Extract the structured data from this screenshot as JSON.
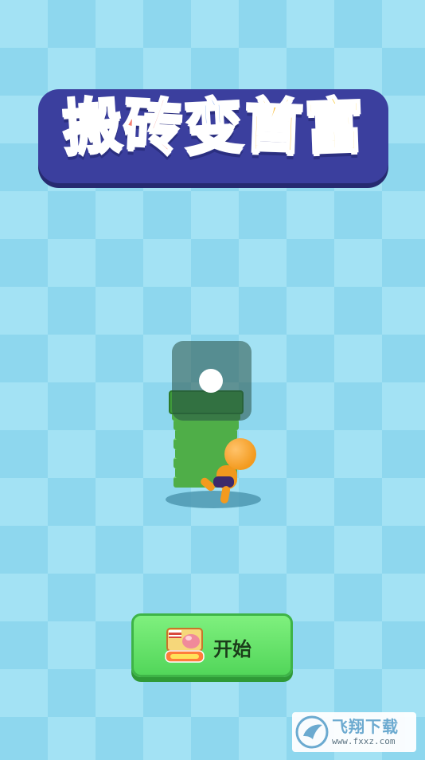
{
  "title": {
    "chars": [
      "搬",
      "砖",
      "变",
      "首",
      "富"
    ]
  },
  "start_button": {
    "label": "开始",
    "icon": "ad-video-icon"
  },
  "watermark": {
    "brand": "飞翔下载",
    "url": "www.fxxz.com",
    "icon": "wing-logo-icon"
  },
  "colors": {
    "background": "#a3e2f4",
    "checker": "#8ed7ee",
    "title_plate": "#3b3f9e",
    "button_green": "#5fdc62"
  }
}
